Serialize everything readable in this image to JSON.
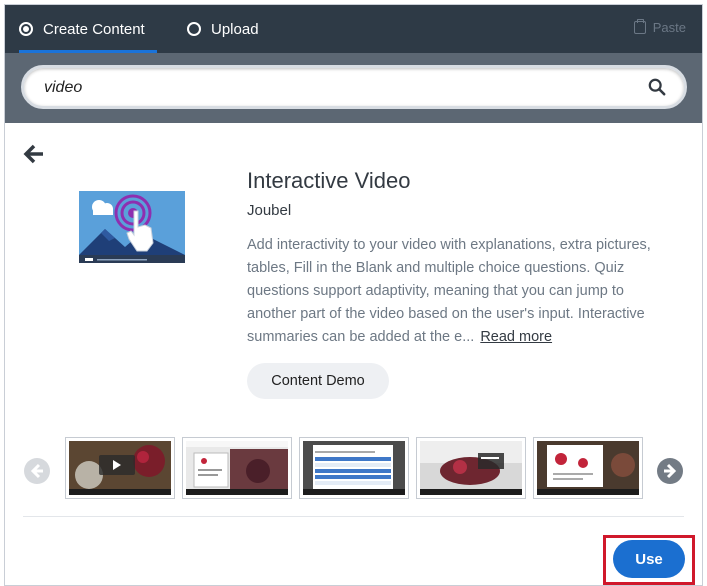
{
  "tabs": [
    {
      "label": "Create Content",
      "selected": true
    },
    {
      "label": "Upload",
      "selected": false
    }
  ],
  "paste": {
    "label": "Paste",
    "icon": "clipboard-icon"
  },
  "search": {
    "value": "video",
    "icon": "search-icon"
  },
  "back": {
    "icon": "arrow-left-icon"
  },
  "content": {
    "title": "Interactive Video",
    "owner": "Joubel",
    "description": "Add interactivity to your video with explanations, extra pictures, tables, Fill in the Blank and multiple choice questions. Quiz questions support adaptivity, meaning that you can jump to another part of the video based on the user's input. Interactive summaries can be added at the e...",
    "read_more": "Read more",
    "demo_button": "Content Demo"
  },
  "carousel": {
    "prev_icon": "chevron-left-icon",
    "next_icon": "chevron-right-icon",
    "screenshot_count": 5
  },
  "actions": {
    "use_button": "Use"
  },
  "colors": {
    "tabbar": "#2e3a46",
    "searchband": "#5c6773",
    "accent": "#1b6fd0",
    "highlight": "#d0182b"
  }
}
